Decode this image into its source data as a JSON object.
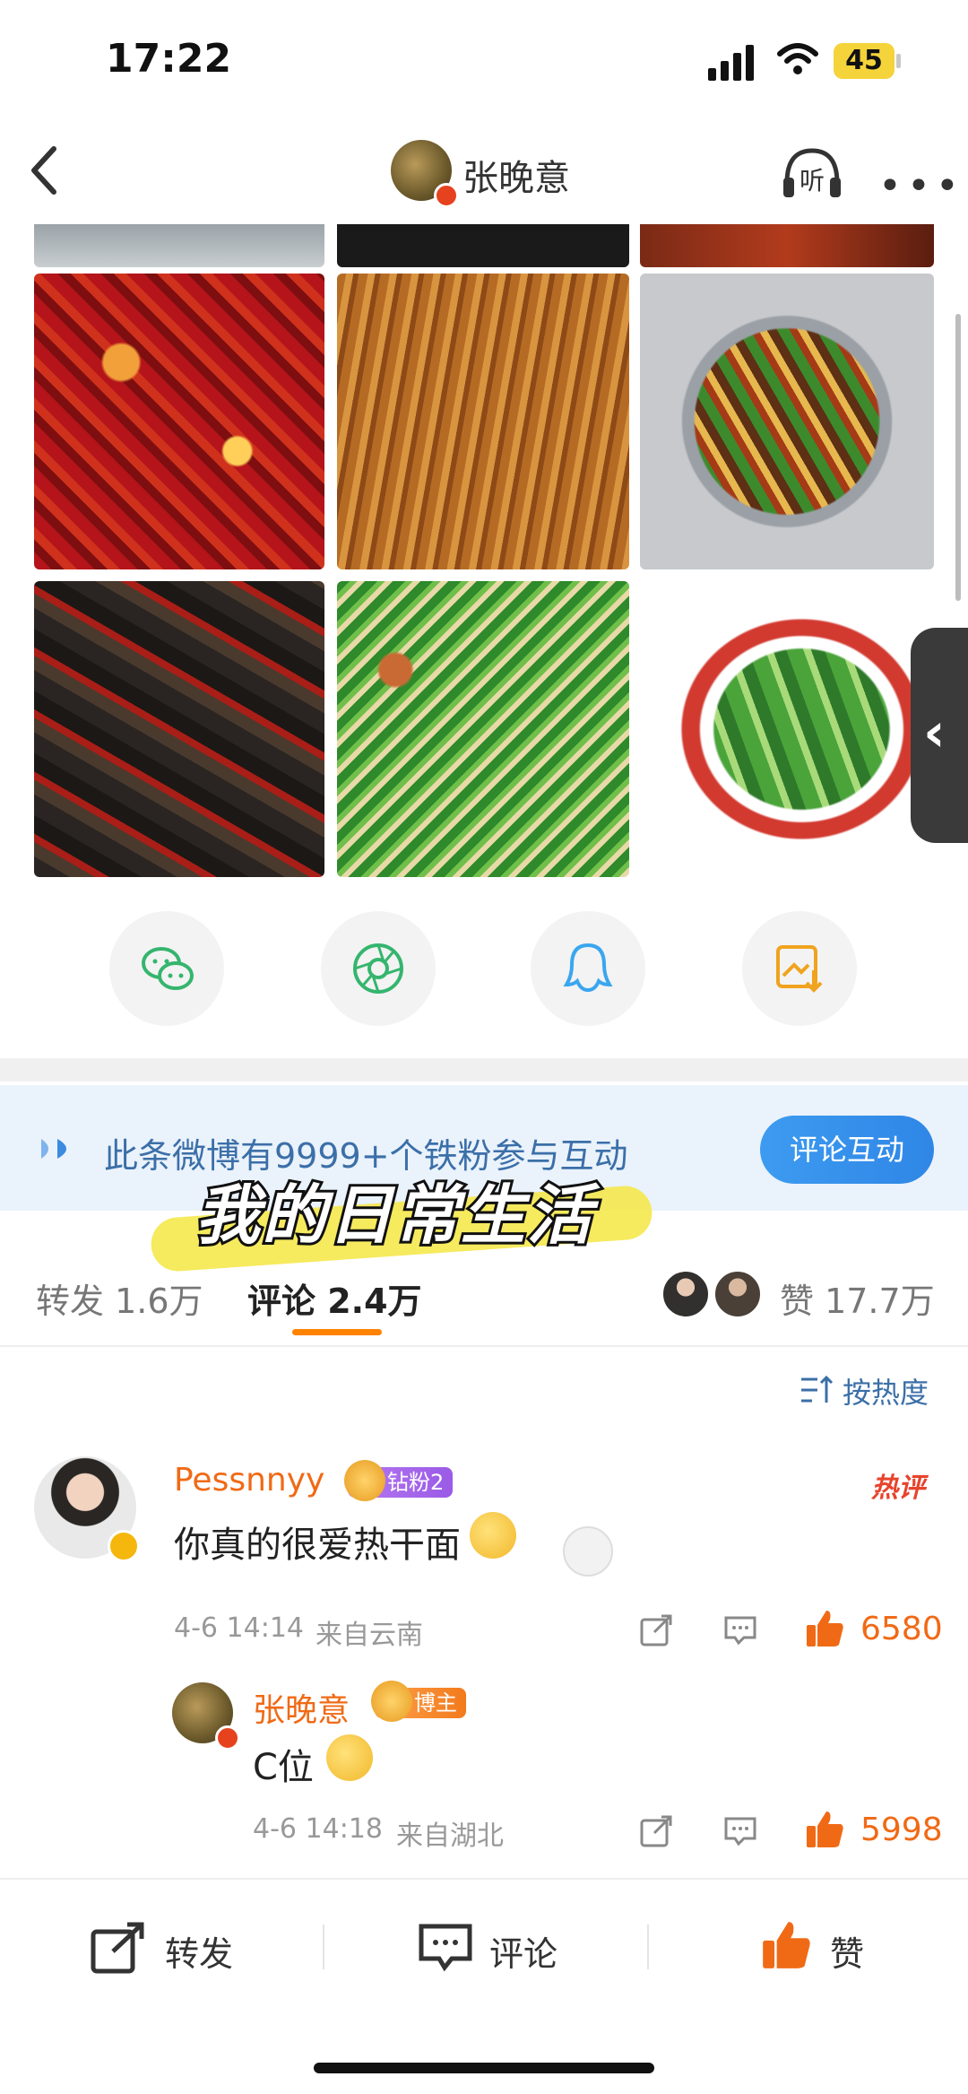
{
  "status": {
    "time": "17:22",
    "battery": "45"
  },
  "header": {
    "name": "张晚意",
    "listen_label": "听",
    "more_label": "•••"
  },
  "share": {
    "items": [
      "wechat-icon",
      "moments-icon",
      "qq-icon",
      "save-image-icon"
    ]
  },
  "banner": {
    "text": "此条微博有9999+个铁粉参与互动",
    "button": "评论互动"
  },
  "overlay_caption": "我的日常生活",
  "tabs": {
    "repost": "转发 1.6万",
    "comment": "评论 2.4万",
    "like": "赞 17.7万"
  },
  "sort_label": "按热度",
  "comments": [
    {
      "user": "Pessnnyy",
      "badge": "钻粉2",
      "tag": "热评",
      "text": "你真的很爱热干面",
      "time": "4-6 14:14",
      "location": "来自云南",
      "likes": "6580",
      "reply": {
        "user": "张晚意",
        "badge": "博主",
        "text": "C位",
        "time": "4-6 14:18",
        "location": "来自湖北",
        "likes": "5998"
      }
    }
  ],
  "bottom_bar": {
    "repost": "转发",
    "comment": "评论",
    "like": "赞"
  },
  "colors": {
    "accent": "#ff8200",
    "link": "#3b6fa8",
    "like": "#f06a16"
  }
}
